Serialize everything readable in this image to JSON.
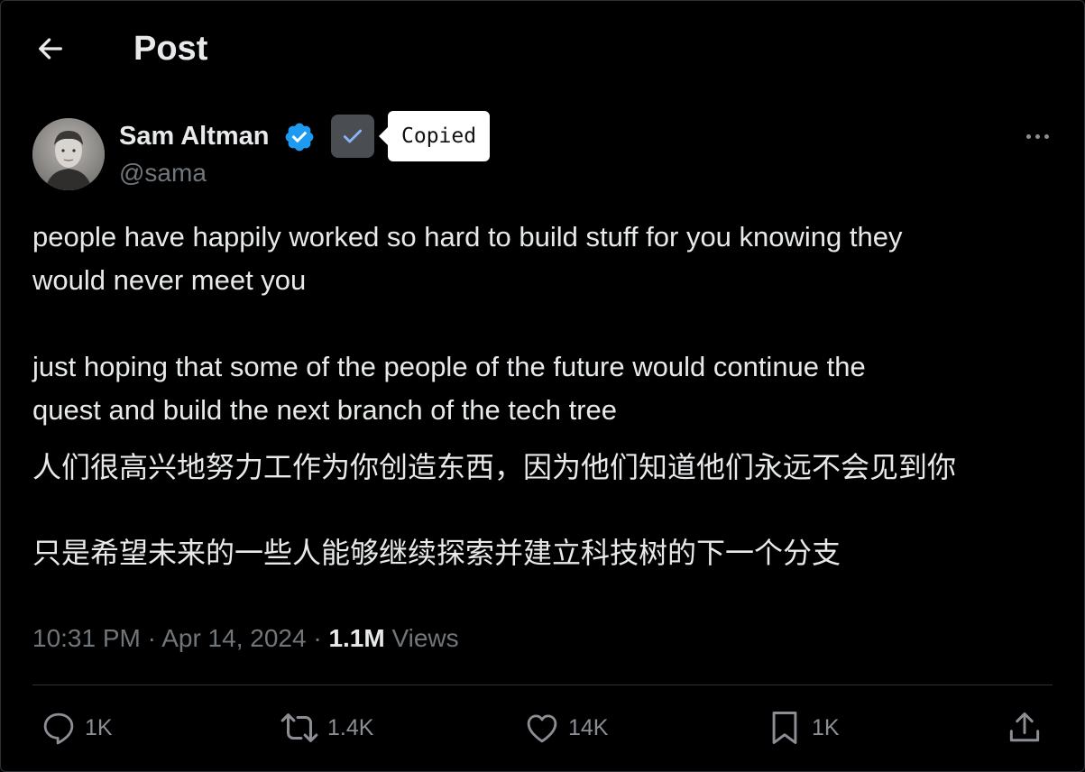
{
  "header": {
    "title": "Post",
    "back_icon": "arrow-left-icon"
  },
  "author": {
    "name": "Sam Altman",
    "handle": "@sama",
    "verified": true,
    "verified_color": "#1d9bf0"
  },
  "copy_tooltip": {
    "label": "Copied"
  },
  "post": {
    "paragraph_en_1": "people have happily worked so hard to build stuff for you knowing they\nwould never meet you",
    "paragraph_en_2": "just hoping that some of the people of the future would continue the\nquest and build the next branch of the tech tree",
    "paragraph_zh_1": "人们很高兴地努力工作为你创造东西，因为他们知道他们永远不会见到你",
    "paragraph_zh_2": "只是希望未来的一些人能够继续探索并建立科技树的下一个分支"
  },
  "meta": {
    "time": "10:31 PM",
    "separator": "·",
    "date": "Apr 14, 2024",
    "views_count": "1.1M",
    "views_label": "Views"
  },
  "actions": {
    "replies": "1K",
    "reposts": "1.4K",
    "likes": "14K",
    "bookmarks": "1K"
  },
  "colors": {
    "background": "#000000",
    "text_primary": "#e7e9ea",
    "text_secondary": "#71767b",
    "accent": "#1d9bf0"
  }
}
